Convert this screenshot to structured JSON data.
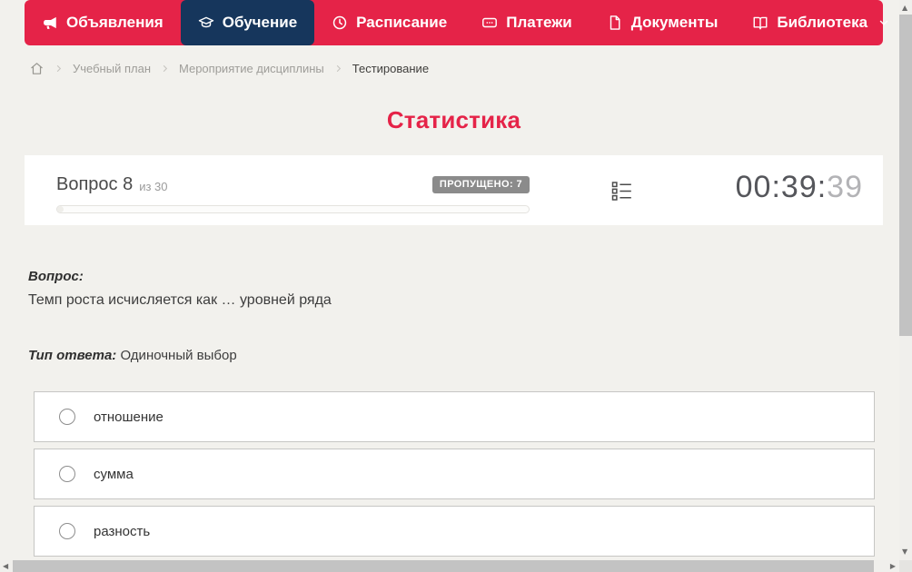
{
  "nav": {
    "items": [
      {
        "label": "Объявления",
        "icon": "megaphone",
        "active": false
      },
      {
        "label": "Обучение",
        "icon": "graduation-cap",
        "active": true
      },
      {
        "label": "Расписание",
        "icon": "clock",
        "active": false
      },
      {
        "label": "Платежи",
        "icon": "payments",
        "active": false
      },
      {
        "label": "Документы",
        "icon": "document",
        "active": false
      },
      {
        "label": "Библиотека",
        "icon": "book",
        "active": false,
        "has_dropdown": true
      }
    ]
  },
  "breadcrumb": {
    "items": [
      "Учебный план",
      "Мероприятие дисциплины",
      "Тестирование"
    ]
  },
  "page": {
    "title": "Статистика"
  },
  "quiz": {
    "question_label": "Вопрос 8",
    "question_total": "из 30",
    "skipped_badge": "ПРОПУЩЕНО: 7",
    "timer_main": "00:39:",
    "timer_seconds": "39",
    "question_heading": "Вопрос:",
    "question_text": "Темп роста исчисляется как … уровней ряда",
    "answer_type_label": "Тип ответа:",
    "answer_type_value": "Одиночный выбор",
    "options": [
      {
        "label": "отношение",
        "selected": false
      },
      {
        "label": "сумма",
        "selected": false
      },
      {
        "label": "разность",
        "selected": false
      }
    ]
  },
  "colors": {
    "accent_red": "#e52348",
    "active_navy": "#16365c",
    "badge_gray": "#8b8b8b",
    "page_bg": "#f2f1ed"
  }
}
